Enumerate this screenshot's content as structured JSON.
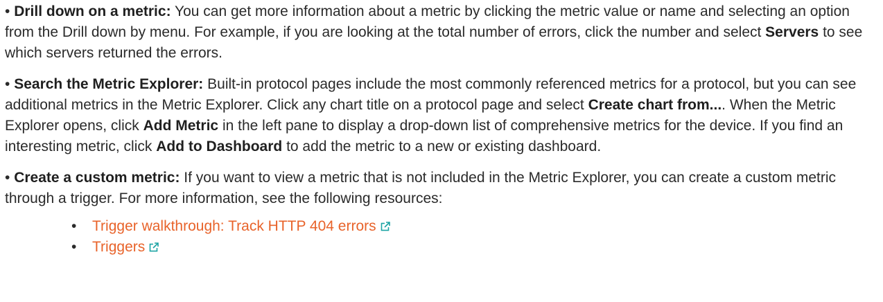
{
  "paragraphs": [
    {
      "bullet": "•",
      "title": "Drill down on a metric:",
      "t1": " You can get more information about a metric by clicking the metric value or name and selecting an option from the Drill down by menu. For example, if you are looking at the total number of errors, click the number and select ",
      "b1": "Servers",
      "t2": " to see which servers returned the errors."
    },
    {
      "bullet": "•",
      "title": "Search the Metric Explorer:",
      "t1": " Built-in protocol pages include the most commonly referenced metrics for a protocol, but you can see additional metrics in the Metric Explorer. Click any chart title on a protocol page and select ",
      "b1": "Create chart from...",
      "t2": ". When the Metric Explorer opens, click ",
      "b2": "Add Metric",
      "t3": " in the left pane to display a drop-down list of comprehensive metrics for the device. If you find an interesting metric, click ",
      "b3": "Add to Dashboard",
      "t4": " to add the metric to a new or existing dashboard."
    },
    {
      "bullet": "•",
      "title": "Create a custom metric:",
      "t1": " If you want to view a metric that is not included in the Metric Explorer, you can create a custom metric through a trigger. For more information, see the following resources:"
    }
  ],
  "resources": [
    {
      "bullet": "•",
      "label": "Trigger walkthrough: Track HTTP 404 errors",
      "icon": "external-link-icon"
    },
    {
      "bullet": "•",
      "label": "Triggers",
      "icon": "external-link-icon"
    }
  ],
  "colors": {
    "link": "#e8632a",
    "icon": "#1aa3a3",
    "text": "#2a2a2a"
  }
}
